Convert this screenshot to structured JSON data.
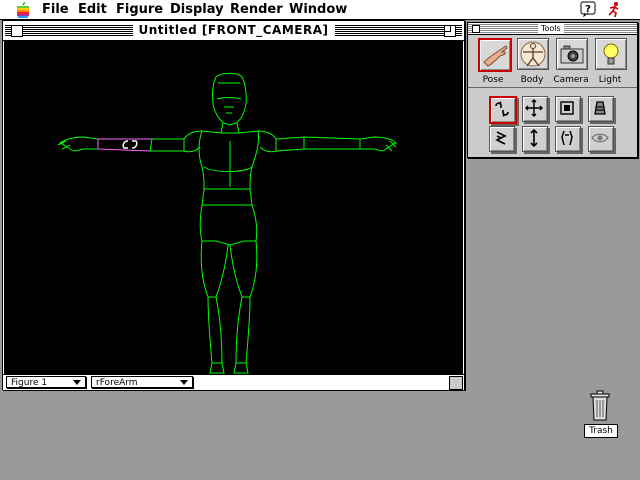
{
  "menubar": {
    "items": [
      "File",
      "Edit",
      "Figure",
      "Display",
      "Render",
      "Window"
    ]
  },
  "window": {
    "title": "Untitled [FRONT_CAMERA]"
  },
  "status": {
    "figure_select": "Figure 1",
    "part_select": "rForeArm"
  },
  "tools": {
    "title": "Tools",
    "buttons": [
      {
        "label": "Pose",
        "icon": "hand-icon",
        "selected": true
      },
      {
        "label": "Body",
        "icon": "vitruvian-figure-icon",
        "selected": false
      },
      {
        "label": "Camera",
        "icon": "camera-icon",
        "selected": false
      },
      {
        "label": "Light",
        "icon": "lightbulb-icon",
        "selected": false
      }
    ],
    "small_tools": [
      "rotate-icon",
      "move-icon",
      "scale-icon",
      "taper-icon",
      "twist-icon",
      "translate-icon",
      "chain-icon",
      "view-icon"
    ]
  },
  "desktop": {
    "trash_label": "Trash"
  },
  "colors": {
    "wireframe": "#00ff00",
    "selected_part": "#ff66ff",
    "selected_tool_border": "#cc0000"
  }
}
